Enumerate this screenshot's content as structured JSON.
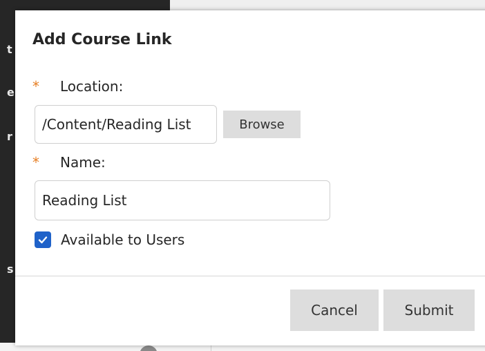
{
  "background": {
    "peek_letters": [
      "t",
      "e",
      "r",
      "s"
    ]
  },
  "dialog": {
    "title": "Add Course Link",
    "location": {
      "required_mark": "*",
      "label": "Location:",
      "value": "/Content/Reading List",
      "browse_label": "Browse"
    },
    "name": {
      "required_mark": "*",
      "label": "Name:",
      "value": "Reading List"
    },
    "available": {
      "label": "Available to Users",
      "checked": true
    },
    "footer": {
      "cancel_label": "Cancel",
      "submit_label": "Submit"
    }
  },
  "colors": {
    "required_star": "#e67e22",
    "checkbox_fill": "#1f62c9",
    "button_bg": "#dddddd"
  }
}
